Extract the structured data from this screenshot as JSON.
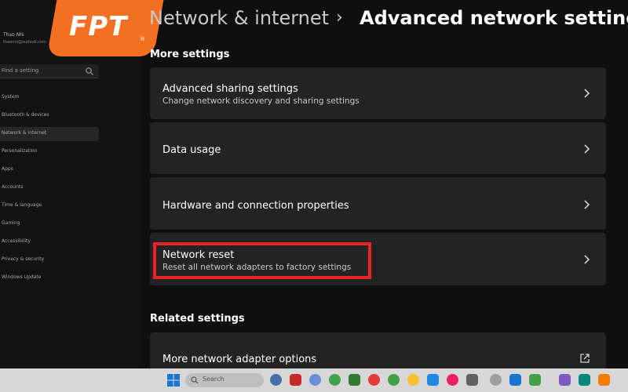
{
  "brand": {
    "logo_text": "FPT",
    "logo_reg": "®",
    "color": "#f37021"
  },
  "sidebar": {
    "user_name": "Thao Nhi",
    "user_email": "thaonhi@outlook.com",
    "search_placeholder": "Find a setting",
    "items": [
      {
        "label": "System",
        "active": false
      },
      {
        "label": "Bluetooth & devices",
        "active": false
      },
      {
        "label": "Network & internet",
        "active": true
      },
      {
        "label": "Personalization",
        "active": false
      },
      {
        "label": "Apps",
        "active": false
      },
      {
        "label": "Accounts",
        "active": false
      },
      {
        "label": "Time & language",
        "active": false
      },
      {
        "label": "Gaming",
        "active": false
      },
      {
        "label": "Accessibility",
        "active": false
      },
      {
        "label": "Privacy & security",
        "active": false
      },
      {
        "label": "Windows Update",
        "active": false
      }
    ]
  },
  "breadcrumb": {
    "parent": "Network & internet",
    "separator": "›",
    "current": "Advanced network settings"
  },
  "sections": {
    "more_settings": "More settings",
    "related_settings": "Related settings"
  },
  "cards": {
    "advanced_sharing": {
      "title": "Advanced sharing settings",
      "subtitle": "Change network discovery and sharing settings"
    },
    "data_usage": {
      "title": "Data usage"
    },
    "hardware": {
      "title": "Hardware and connection properties"
    },
    "network_reset": {
      "title": "Network reset",
      "subtitle": "Reset all network adapters to factory settings"
    },
    "adapter_options": {
      "title": "More network adapter options"
    }
  },
  "taskbar": {
    "search_placeholder": "Search"
  },
  "colors": {
    "background": "#0f0f0f",
    "card": "#232323",
    "highlight": "#e8242b",
    "accent": "#f37021"
  }
}
